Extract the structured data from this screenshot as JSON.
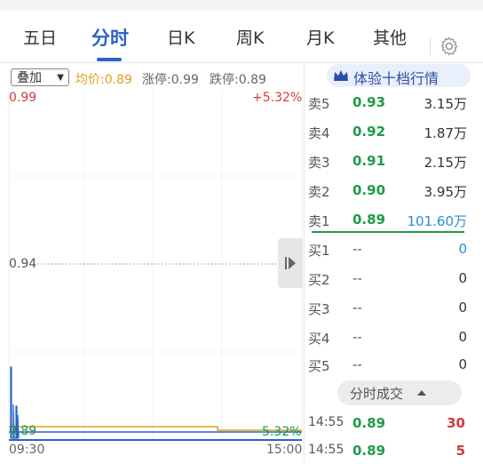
{
  "tabs": [
    "五日",
    "分时",
    "日K",
    "周K",
    "月K",
    "其他"
  ],
  "active_tab": "分时",
  "toolbar": {
    "overlay": "叠加",
    "avg_price": "均价:0.89",
    "limit_up": "涨停:0.99",
    "limit_down": "跌停:0.89"
  },
  "chart": {
    "y_max": "0.99",
    "y_mid": "0.94",
    "y_min": "0.89",
    "pct_max": "+5.32%",
    "pct_min": "-5.32%",
    "time_start": "09:30",
    "time_end": "15:00"
  },
  "orderbook": {
    "title": "体验十档行情",
    "asks": [
      {
        "name": "卖5",
        "price": "0.93",
        "vol": "3.15万"
      },
      {
        "name": "卖4",
        "price": "0.92",
        "vol": "1.87万"
      },
      {
        "name": "卖3",
        "price": "0.91",
        "vol": "2.15万"
      },
      {
        "name": "卖2",
        "price": "0.90",
        "vol": "3.95万"
      },
      {
        "name": "卖1",
        "price": "0.89",
        "vol": "101.60万"
      }
    ],
    "bids": [
      {
        "name": "买1",
        "price": "--",
        "vol": "0"
      },
      {
        "name": "买2",
        "price": "--",
        "vol": "0"
      },
      {
        "name": "买3",
        "price": "--",
        "vol": "0"
      },
      {
        "name": "买4",
        "price": "--",
        "vol": "0"
      },
      {
        "name": "买5",
        "price": "--",
        "vol": "0"
      }
    ]
  },
  "trades": {
    "label": "分时成交",
    "rows": [
      {
        "time": "14:55",
        "price": "0.89",
        "vol": "30"
      },
      {
        "time": "14:55",
        "price": "0.89",
        "vol": "5"
      }
    ]
  },
  "colors": {
    "accent": "#2a62c9",
    "up": "#d13b3b",
    "down": "#1f9a4a",
    "avg": "#e0a020"
  }
}
